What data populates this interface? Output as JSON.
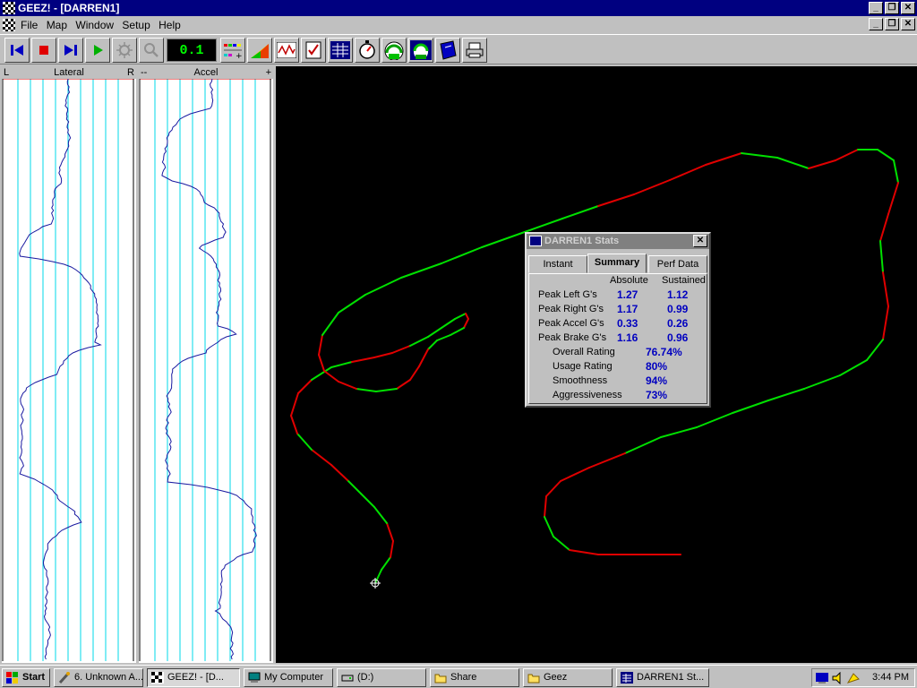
{
  "window": {
    "title": "GEEZ! - [DARREN1]",
    "btn_min": "_",
    "btn_restore": "❐",
    "btn_close": "✕"
  },
  "menu": {
    "items": [
      "File",
      "Map",
      "Window",
      "Setup",
      "Help"
    ]
  },
  "toolbar": {
    "speed_display": "0.1",
    "icons": [
      "skip-back-icon",
      "stop-icon",
      "skip-forward-icon",
      "play-icon",
      "brightness-icon",
      "zoom-icon",
      "color-scale-icon",
      "color-gradient-icon",
      "graph-icon",
      "checklist-icon",
      "data-grid-icon",
      "stopwatch-icon",
      "gauge-icon",
      "dial-icon",
      "book-icon",
      "printer-icon"
    ]
  },
  "lateral_panel": {
    "left_label": "L",
    "title": "Lateral",
    "right_label": "R"
  },
  "accel_panel": {
    "left_label": "--",
    "title": "Accel",
    "right_label": "+"
  },
  "stats_window": {
    "title": "DARREN1 Stats",
    "close": "✕",
    "tabs": [
      "Instant",
      "Summary",
      "Perf Data"
    ],
    "active_tab": "Summary",
    "col_absolute": "Absolute",
    "col_sustained": "Sustained",
    "rows": [
      {
        "label": "Peak Left G's",
        "absolute": "1.27",
        "sustained": "1.12"
      },
      {
        "label": "Peak Right G's",
        "absolute": "1.17",
        "sustained": "0.99"
      },
      {
        "label": "Peak Accel G's",
        "absolute": "0.33",
        "sustained": "0.26"
      },
      {
        "label": "Peak Brake G's",
        "absolute": "1.16",
        "sustained": "0.96"
      }
    ],
    "ratings": [
      {
        "label": "Overall Rating",
        "value": "76.74%"
      },
      {
        "label": "Usage Rating",
        "value": "80%"
      },
      {
        "label": "Smoothness",
        "value": "94%"
      },
      {
        "label": "Aggressiveness",
        "value": "73%"
      }
    ]
  },
  "colors": {
    "track_good": "#00e000",
    "track_bad": "#e00000",
    "trace": "#1a1aa0",
    "grid": "#00d8e8"
  },
  "taskbar": {
    "start": "Start",
    "tasks": [
      {
        "label": "6. Unknown A...",
        "icon": "wrench-icon"
      },
      {
        "label": "GEEZ! - [D...",
        "icon": "checker-icon"
      },
      {
        "label": "My Computer",
        "icon": "computer-icon"
      },
      {
        "label": "(D:)",
        "icon": "drive-icon"
      },
      {
        "label": "Share",
        "icon": "folder-icon"
      },
      {
        "label": "Geez",
        "icon": "folder-icon"
      },
      {
        "label": "DARREN1 St...",
        "icon": "stats-icon"
      }
    ],
    "clock": "3:44 PM"
  }
}
